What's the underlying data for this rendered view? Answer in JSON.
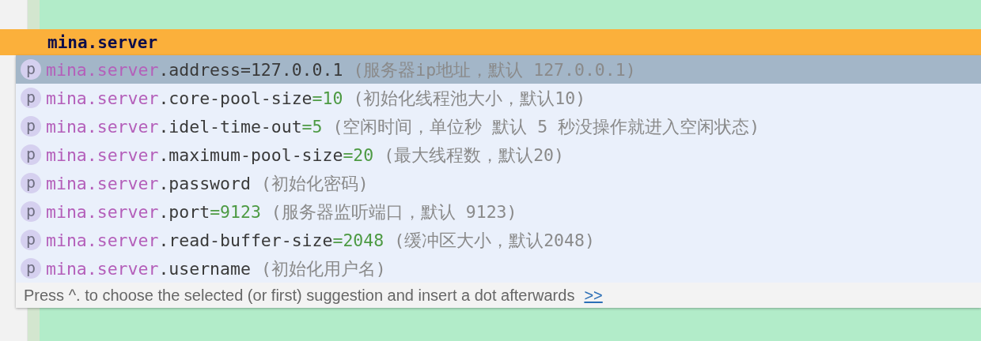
{
  "editor": {
    "current_line": "mina.server"
  },
  "suggestions": [
    {
      "prefix": "mina.server",
      "name": ".address",
      "value": "=127.0.0.1",
      "comment": "(服务器ip地址，默认 127.0.0.1)",
      "icon": "p",
      "selected": true
    },
    {
      "prefix": "mina.server",
      "name": ".core-pool-size",
      "value": "=10",
      "comment": "(初始化线程池大小，默认10)",
      "icon": "p",
      "selected": false
    },
    {
      "prefix": "mina.server",
      "name": ".idel-time-out",
      "value": "=5",
      "comment": "(空闲时间，单位秒 默认 5 秒没操作就进入空闲状态)",
      "icon": "p",
      "selected": false
    },
    {
      "prefix": "mina.server",
      "name": ".maximum-pool-size",
      "value": "=20",
      "comment": "(最大线程数，默认20)",
      "icon": "p",
      "selected": false
    },
    {
      "prefix": "mina.server",
      "name": ".password",
      "comment": "(初始化密码)",
      "icon": "p",
      "selected": false
    },
    {
      "prefix": "mina.server",
      "name": ".port",
      "value": "=9123",
      "comment": "(服务器监听端口，默认 9123)",
      "icon": "p",
      "selected": false
    },
    {
      "prefix": "mina.server",
      "name": ".read-buffer-size",
      "value": "=2048",
      "comment": "(缓冲区大小，默认2048)",
      "icon": "p",
      "selected": false
    },
    {
      "prefix": "mina.server",
      "name": ".username",
      "comment": "(初始化用户名)",
      "icon": "p",
      "selected": false
    }
  ],
  "footer": {
    "hint": "Press ^. to choose the selected (or first) suggestion and insert a dot afterwards",
    "link": ">>"
  }
}
